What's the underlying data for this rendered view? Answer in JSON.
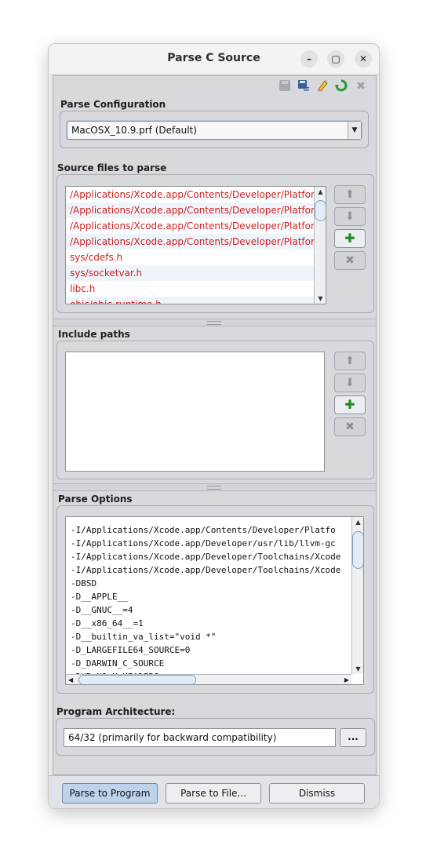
{
  "window": {
    "title": "Parse C Source",
    "controls": {
      "minimize": "–",
      "maximize": "▢",
      "close": "✕"
    }
  },
  "toolbar": {
    "icons": [
      "save-icon",
      "save-as-icon",
      "clear-icon",
      "refresh-icon",
      "delete-icon"
    ]
  },
  "parse_config": {
    "label": "Parse Configuration",
    "selected": "MacOSX_10.9.prf (Default)"
  },
  "source_files": {
    "label": "Source files to parse",
    "items": [
      "/Applications/Xcode.app/Contents/Developer/Platfor...",
      "/Applications/Xcode.app/Contents/Developer/Platfor...",
      "/Applications/Xcode.app/Contents/Developer/Platfor...",
      "/Applications/Xcode.app/Contents/Developer/Platfor...",
      "sys/cdefs.h",
      "sys/socketvar.h",
      "libc.h",
      "objc/objc-runtime.h"
    ]
  },
  "include_paths": {
    "label": "Include paths",
    "items": []
  },
  "parse_options": {
    "label": "Parse Options",
    "lines": [
      "-I/Applications/Xcode.app/Contents/Developer/Platfo",
      "-I/Applications/Xcode.app/Developer/usr/lib/llvm-gc",
      "-I/Applications/Xcode.app/Developer/Toolchains/Xcode",
      "-I/Applications/Xcode.app/Developer/Toolchains/Xcode",
      "-DBSD",
      "-D__APPLE__",
      "-D__GNUC__=4",
      "-D__x86_64__=1",
      "-D__builtin_va_list=\"void *\"",
      "-D_LARGEFILE64_SOURCE=0",
      "-D_DARWIN_C_SOURCE",
      "-DYB_NO_X_HEADERS"
    ]
  },
  "program_architecture": {
    "label": "Program Architecture:",
    "value": "64/32 (primarily for backward compatibility)",
    "browse_label": "..."
  },
  "buttons": {
    "parse_to_program": "Parse to Program",
    "parse_to_file": "Parse to File...",
    "dismiss": "Dismiss"
  },
  "colors": {
    "source_file_text": "#cc1f1f",
    "add_button": "#1e8a20",
    "panel_bg": "#d7d9dd"
  }
}
